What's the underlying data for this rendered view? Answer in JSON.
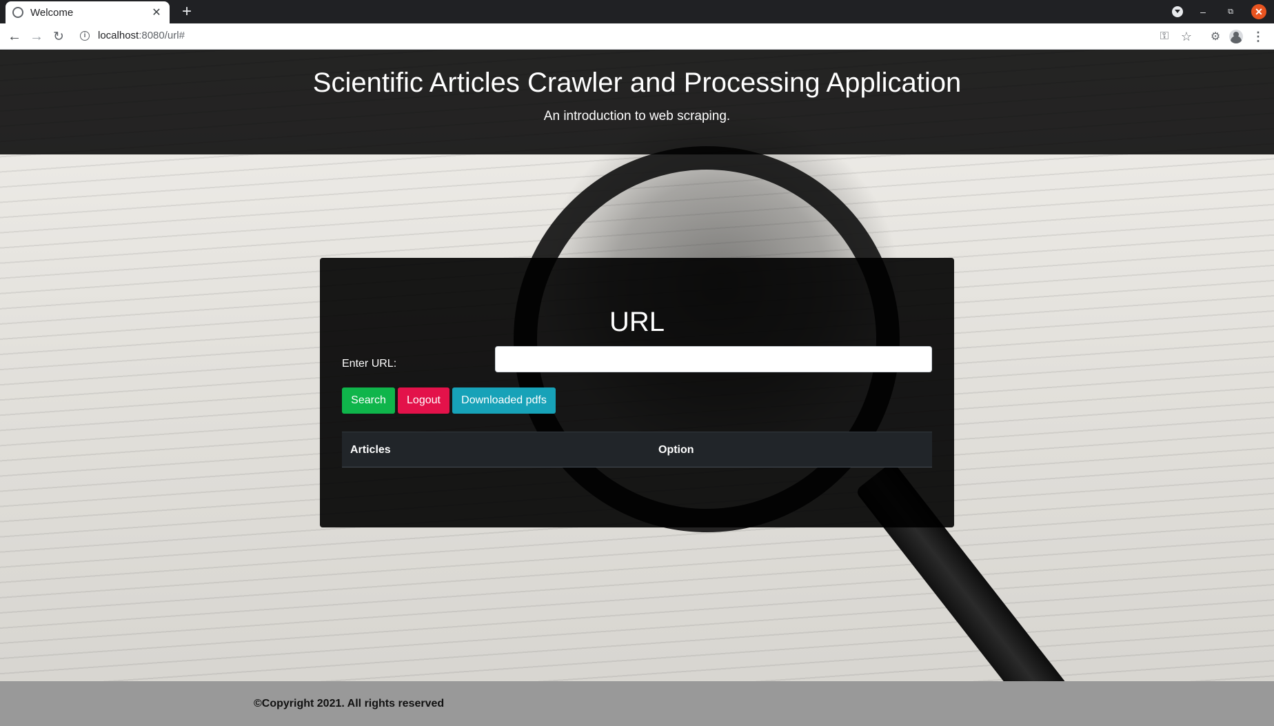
{
  "browser": {
    "tab_title": "Welcome",
    "tab_close": "✕",
    "new_tab": "+",
    "url_host": "localhost",
    "url_rest": ":8080/url#",
    "window_controls": {
      "minimize": "–",
      "maximize": "⧉",
      "close": "✕"
    },
    "icons": [
      "back-arrow-icon",
      "forward-arrow-icon",
      "reload-icon",
      "site-info-icon",
      "key-icon",
      "star-icon",
      "puzzle-extension-icon",
      "profile-icon",
      "kebab-menu-icon"
    ]
  },
  "hero": {
    "title": "Scientific Articles Crawler and Processing Application",
    "subtitle": "An introduction to web scraping."
  },
  "card": {
    "title": "URL",
    "url_label": "Enter URL:",
    "url_value": "",
    "url_placeholder": "",
    "buttons": {
      "search": "Search",
      "logout": "Logout",
      "downloaded": "Downloaded pdfs"
    },
    "table": {
      "headers": [
        "Articles",
        "Option"
      ],
      "rows": []
    }
  },
  "footer": {
    "text": "©Copyright 2021. All rights reserved"
  },
  "colors": {
    "search_button": "#0fb54b",
    "logout_button": "#e3124a",
    "downloaded_button": "#17a2b8",
    "footer_bg": "#999999"
  }
}
